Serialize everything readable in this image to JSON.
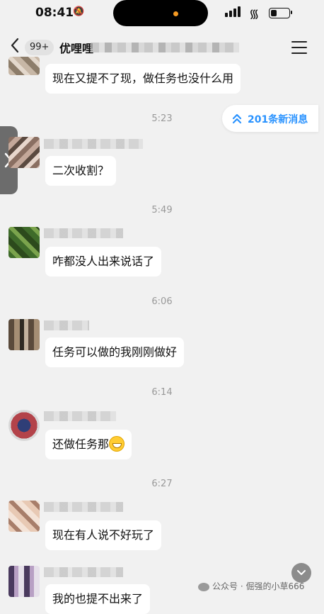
{
  "status_bar": {
    "time": "08:41",
    "bell_icon": "bell-slash-icon",
    "wifi_icon": "wifi-icon",
    "signal_icon": "cellular-signal-icon",
    "battery_level": 0.35
  },
  "nav": {
    "back_icon": "chevron-left-icon",
    "unread_count": "99+",
    "title": "优哩哩",
    "menu_icon": "hamburger-menu-icon"
  },
  "new_messages": {
    "icon": "double-chevron-up-icon",
    "label": "201条新消息",
    "accent": "#2a93ff"
  },
  "side_tab": {
    "icon": "chevron-right-icon"
  },
  "messages": [
    {
      "text": "现在又提不了现，做任务也没什么用"
    },
    {
      "time": "5:23",
      "text": "二次收割？"
    },
    {
      "time": "5:49",
      "text": "咋都没人出来说话了"
    },
    {
      "time": "6:06",
      "text": "任务可以做的我刚刚做好"
    },
    {
      "time": "6:14",
      "text": "还做任务那",
      "emoji": "grinning-face-emoji"
    },
    {
      "time": "6:27",
      "text": "现在有人说不好玩了"
    },
    {
      "text": "我的也提不出来了"
    }
  ],
  "scroll_down_icon": "chevron-down-icon",
  "watermark": {
    "icon": "wechat-icon",
    "text": "公众号 · 倔强的小草666"
  }
}
